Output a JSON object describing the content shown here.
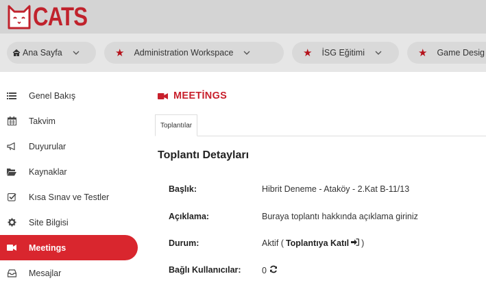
{
  "brand": {
    "logo_text": "CATS",
    "accent": "#c8202c"
  },
  "site_tabs": [
    {
      "label": "Ana Sayfa",
      "icon": "home-icon",
      "dropdown": true
    },
    {
      "label": "Administration Workspace",
      "icon": "star-icon",
      "dropdown": true
    },
    {
      "label": "İSG Eğitimi",
      "icon": "star-icon",
      "dropdown": true
    },
    {
      "label": "Game Desig",
      "icon": "star-icon",
      "dropdown": false
    }
  ],
  "sidebar": {
    "items": [
      {
        "label": "Genel Bakış",
        "icon": "list-icon",
        "active": false
      },
      {
        "label": "Takvim",
        "icon": "calendar-icon",
        "active": false
      },
      {
        "label": "Duyurular",
        "icon": "bullhorn-icon",
        "active": false
      },
      {
        "label": "Kaynaklar",
        "icon": "folder-icon",
        "active": false
      },
      {
        "label": "Kısa Sınav ve Testler",
        "icon": "checkbox-icon",
        "active": false
      },
      {
        "label": "Site Bilgisi",
        "icon": "gear-icon",
        "active": false
      },
      {
        "label": "Meetings",
        "icon": "video-icon",
        "active": true
      },
      {
        "label": "Mesajlar",
        "icon": "inbox-icon",
        "active": false
      }
    ]
  },
  "main": {
    "title": "MEETİNGS",
    "tab": "Toplantılar",
    "section_title": "Toplantı Detayları",
    "details": {
      "title_label": "Başlık:",
      "title_value": "Hibrit Deneme - Ataköy - 2.Kat B-11/13",
      "desc_label": "Açıklama:",
      "desc_value": "Buraya toplantı hakkında açıklama giriniz",
      "status_label": "Durum:",
      "status_value": "Aktif (",
      "join_label": "Toplantıya Katıl",
      "status_close": ")",
      "users_label": "Bağlı Kullanıcılar:",
      "users_count": "0"
    }
  }
}
